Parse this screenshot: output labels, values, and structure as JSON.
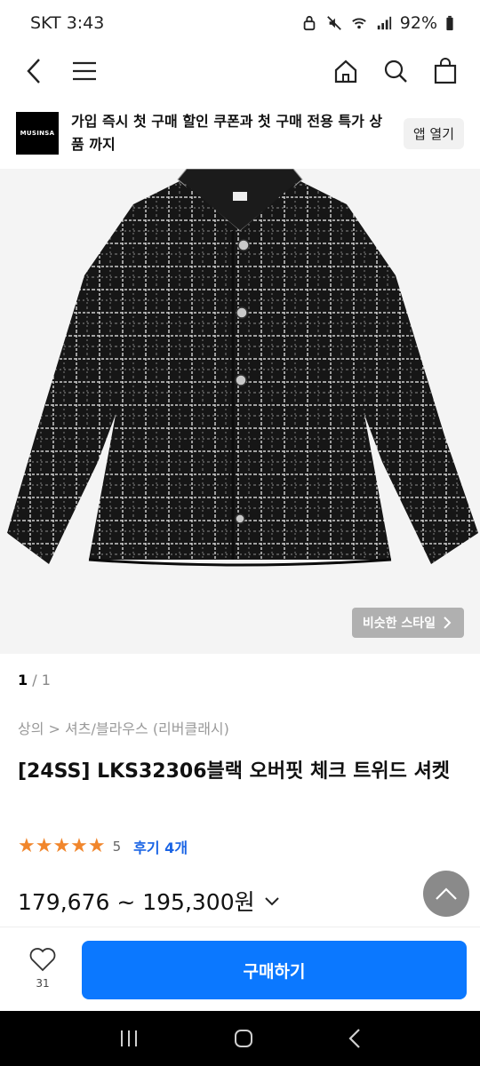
{
  "status": {
    "carrier_time": "SKT 3:43",
    "battery": "92%"
  },
  "banner": {
    "logo_text": "MUSINSA",
    "text": "가입 즉시 첫 구매 할인 쿠폰과 첫 구매 전용 특가 상품 까지",
    "app_button": "앱 열기"
  },
  "image": {
    "similar_style_label": "비슷한 스타일"
  },
  "pager": {
    "current": "1",
    "total": " / 1"
  },
  "breadcrumb": "상의 > 셔츠/블라우스 (리버클래시)",
  "product": {
    "title": "[24SS] LKS32306블랙 오버핏 체크 트위드 셔켓",
    "stars": "★★★★★",
    "rating": "5",
    "reviews": "후기 4개",
    "price": "179,676 ~ 195,300원"
  },
  "bottom": {
    "like_count": "31",
    "buy_label": "구매하기"
  },
  "colors": {
    "accent": "#0b78ff",
    "star": "#f1862c",
    "review_link": "#1a64e5"
  }
}
